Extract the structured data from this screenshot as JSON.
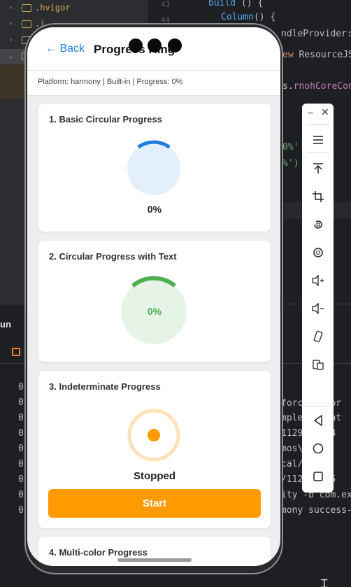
{
  "ide": {
    "tree": [
      {
        "name": ".hvigor",
        "chev": "›"
      },
      {
        "name": ".i",
        "chev": "›"
      },
      {
        "name": "",
        "chev": "›"
      },
      {
        "name": "",
        "chev": "›"
      },
      {
        "name": "",
        "chev": "⌄"
      }
    ],
    "line_numbers": [
      "43",
      "44"
    ],
    "code_lines": [
      {
        "a": "build",
        "b": "() {"
      },
      {
        "a": "Column",
        "b": "() {"
      },
      {
        "a": "",
        "b": "ndleProvider:"
      },
      {
        "a": "ew ",
        "b": "ResourceJS"
      },
      {
        "a": "s.",
        "b": "rnohCoreCon"
      },
      {
        "a": "",
        "b": "0%'"
      },
      {
        "a": "",
        "b": "%')"
      }
    ],
    "run_label": "un",
    "console_left": [
      "0",
      "0",
      "0",
      "0",
      "0",
      "0",
      "0",
      "0",
      "0"
    ],
    "console_right": [
      "forc  armor",
      "mple  ctnat",
      "1129  9554",
      "mos\\ ny\\e",
      "cal/ 1292",
      "/112  0955",
      "ity -b com.ex",
      "mony success-"
    ]
  },
  "emulator_toolbar": {
    "minimize_icon": "–",
    "close_icon": "✕",
    "buttons": [
      "menu-icon",
      "pin-top-icon",
      "crop-icon",
      "rotate-icon",
      "screenshot-icon",
      "volume-up-icon",
      "volume-down-icon",
      "rotate-device-icon",
      "fold-icon",
      "back-icon",
      "home-icon",
      "recents-icon"
    ]
  },
  "app": {
    "back_label": "← Back",
    "title": "Progress Ring",
    "info": "Platform: harmony | Built-in | Progress: 0%"
  },
  "cards": {
    "basic": {
      "title": "1. Basic Circular Progress",
      "value_text": "0%",
      "progress": 0
    },
    "with_text": {
      "title": "2. Circular Progress with Text",
      "value_text": "0%",
      "progress": 0
    },
    "indeterminate": {
      "title": "3. Indeterminate Progress",
      "status": "Stopped",
      "button": "Start"
    },
    "multicolor": {
      "title": "4. Multi-color Progress"
    }
  },
  "colors": {
    "accent_blue": "#1f7fe0",
    "ring_blue_fill": "#e3f0fc",
    "ring_green": "#4caf50",
    "ring_green_fill": "#e6f4e7",
    "orange": "#ff9a00",
    "orange_light": "#fde2b8"
  }
}
